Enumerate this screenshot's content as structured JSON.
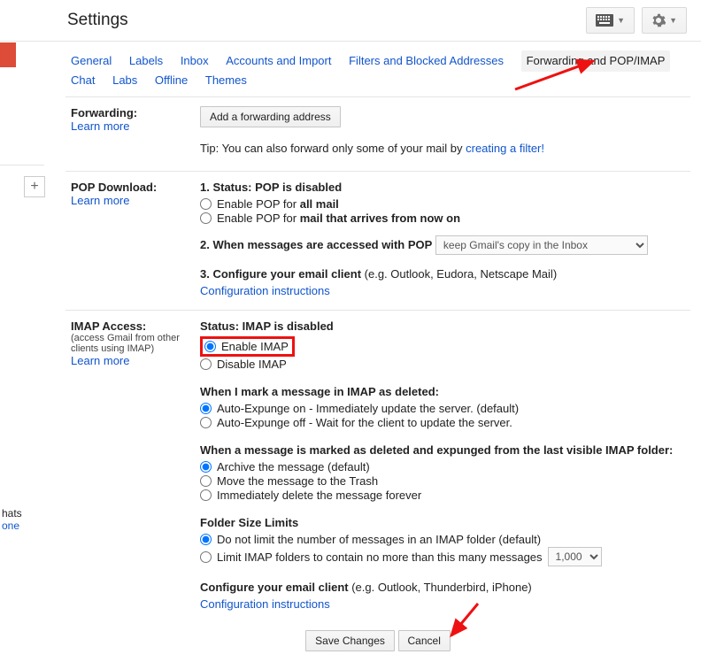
{
  "header": {
    "title": "Settings"
  },
  "left_rail": {
    "hats_text": "hats",
    "one_text": "one"
  },
  "tabs": {
    "general": "General",
    "labels": "Labels",
    "inbox": "Inbox",
    "accounts": "Accounts and Import",
    "filters": "Filters and Blocked Addresses",
    "forwarding": "Forwarding and POP/IMAP",
    "chat": "Chat",
    "labs": "Labs",
    "offline": "Offline",
    "themes": "Themes"
  },
  "forwarding": {
    "label": "Forwarding:",
    "learn_more": "Learn more",
    "add_button": "Add a forwarding address",
    "tip_prefix": "Tip: You can also forward only some of your mail by ",
    "tip_link": "creating a filter!"
  },
  "pop": {
    "label": "POP Download:",
    "learn_more": "Learn more",
    "status_line_prefix": "1. Status: ",
    "status_line_value": "POP is disabled",
    "enable_all_prefix": "Enable POP for ",
    "enable_all_bold": "all mail",
    "enable_now_prefix": "Enable POP for ",
    "enable_now_bold": "mail that arrives from now on",
    "when_accessed": "2. When messages are accessed with POP",
    "keep_copy_option": "keep Gmail's copy in the Inbox",
    "configure_prefix": "3. Configure your email client ",
    "configure_suffix": "(e.g. Outlook, Eudora, Netscape Mail)",
    "config_instructions": "Configuration instructions"
  },
  "imap": {
    "label": "IMAP Access:",
    "sub": "(access Gmail from other clients using IMAP)",
    "learn_more": "Learn more",
    "status_prefix": "Status: ",
    "status_value": "IMAP is disabled",
    "enable": "Enable IMAP",
    "disable": "Disable IMAP",
    "deleted_heading": "When I mark a message in IMAP as deleted:",
    "ae_on": "Auto-Expunge on - Immediately update the server. (default)",
    "ae_off": "Auto-Expunge off - Wait for the client to update the server.",
    "expunged_heading": "When a message is marked as deleted and expunged from the last visible IMAP folder:",
    "archive": "Archive the message (default)",
    "trash": "Move the message to the Trash",
    "delete_forever": "Immediately delete the message forever",
    "folder_limits_heading": "Folder Size Limits",
    "no_limit": "Do not limit the number of messages in an IMAP folder (default)",
    "limit_prefix": "Limit IMAP folders to contain no more than this many messages",
    "limit_value": "1,000",
    "configure_prefix": "Configure your email client ",
    "configure_suffix": "(e.g. Outlook, Thunderbird, iPhone)",
    "config_instructions": "Configuration instructions"
  },
  "footer": {
    "save": "Save Changes",
    "cancel": "Cancel"
  }
}
